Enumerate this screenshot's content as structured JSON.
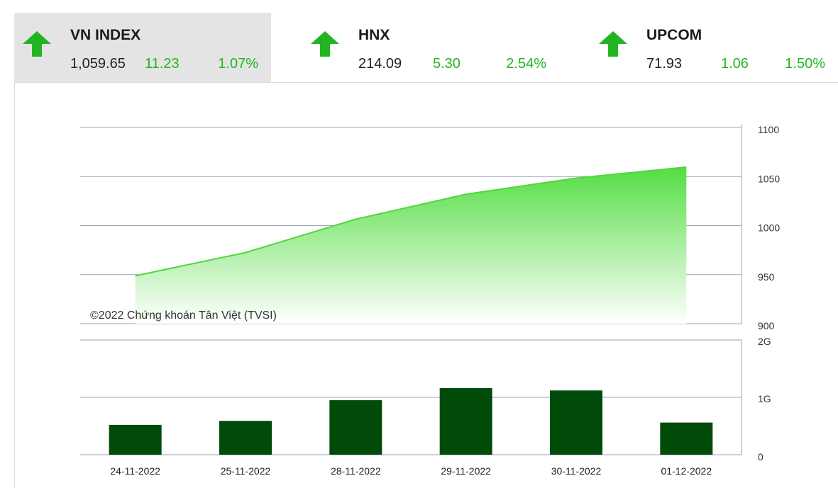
{
  "indices": [
    {
      "name": "VN INDEX",
      "value": "1,059.65",
      "change": "11.23",
      "percent": "1.07%",
      "direction": "up",
      "active": true
    },
    {
      "name": "HNX",
      "value": "214.09",
      "change": "5.30",
      "percent": "2.54%",
      "direction": "up",
      "active": false
    },
    {
      "name": "UPCOM",
      "value": "71.93",
      "change": "1.06",
      "percent": "1.50%",
      "direction": "up",
      "active": false
    }
  ],
  "colors": {
    "up": "#22b522",
    "area_top": "#55dd44",
    "line": "#4fd83c",
    "volume_bar": "#004a0a",
    "grid": "#9aa6b8"
  },
  "watermark": "©2022 Chứng khoán Tân Việt (TVSI)",
  "chart_data": [
    {
      "type": "area",
      "categories": [
        "24-11-2022",
        "25-11-2022",
        "28-11-2022",
        "29-11-2022",
        "30-11-2022",
        "01-12-2022"
      ],
      "values": [
        948.8,
        972.5,
        1006.5,
        1032,
        1048.4,
        1059.65
      ],
      "ylim": [
        900,
        1100
      ],
      "yticks": [
        "900",
        "950",
        "1000",
        "1050",
        "1100"
      ],
      "axis_side": "right",
      "grid": true
    },
    {
      "type": "bar",
      "categories": [
        "24-11-2022",
        "25-11-2022",
        "28-11-2022",
        "29-11-2022",
        "30-11-2022",
        "01-12-2022"
      ],
      "values": [
        0.52,
        0.59,
        0.95,
        1.16,
        1.12,
        0.56
      ],
      "unit": "G",
      "ylim": [
        0,
        2
      ],
      "yticks": [
        "0",
        "1G",
        "2G"
      ],
      "axis_side": "right",
      "grid": true
    }
  ]
}
